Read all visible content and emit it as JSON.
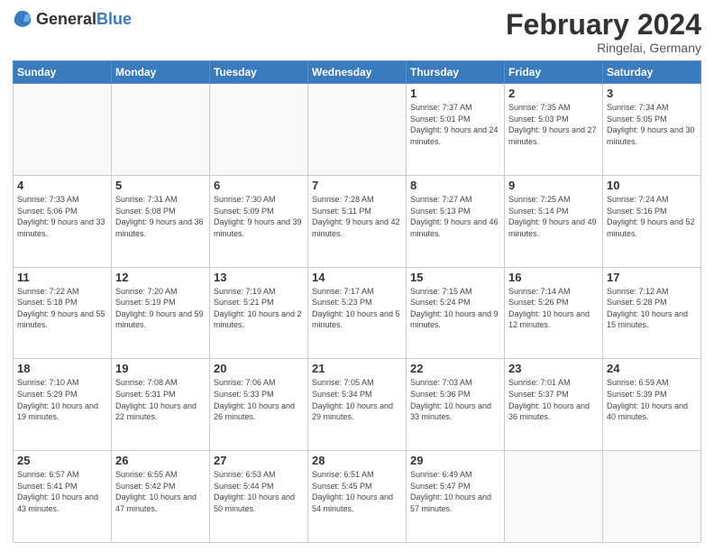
{
  "header": {
    "logo_general": "General",
    "logo_blue": "Blue",
    "month_title": "February 2024",
    "location": "Ringelai, Germany"
  },
  "days_of_week": [
    "Sunday",
    "Monday",
    "Tuesday",
    "Wednesday",
    "Thursday",
    "Friday",
    "Saturday"
  ],
  "weeks": [
    [
      {
        "day": "",
        "info": ""
      },
      {
        "day": "",
        "info": ""
      },
      {
        "day": "",
        "info": ""
      },
      {
        "day": "",
        "info": ""
      },
      {
        "day": "1",
        "info": "Sunrise: 7:37 AM\nSunset: 5:01 PM\nDaylight: 9 hours and 24 minutes."
      },
      {
        "day": "2",
        "info": "Sunrise: 7:35 AM\nSunset: 5:03 PM\nDaylight: 9 hours and 27 minutes."
      },
      {
        "day": "3",
        "info": "Sunrise: 7:34 AM\nSunset: 5:05 PM\nDaylight: 9 hours and 30 minutes."
      }
    ],
    [
      {
        "day": "4",
        "info": "Sunrise: 7:33 AM\nSunset: 5:06 PM\nDaylight: 9 hours and 33 minutes."
      },
      {
        "day": "5",
        "info": "Sunrise: 7:31 AM\nSunset: 5:08 PM\nDaylight: 9 hours and 36 minutes."
      },
      {
        "day": "6",
        "info": "Sunrise: 7:30 AM\nSunset: 5:09 PM\nDaylight: 9 hours and 39 minutes."
      },
      {
        "day": "7",
        "info": "Sunrise: 7:28 AM\nSunset: 5:11 PM\nDaylight: 9 hours and 42 minutes."
      },
      {
        "day": "8",
        "info": "Sunrise: 7:27 AM\nSunset: 5:13 PM\nDaylight: 9 hours and 46 minutes."
      },
      {
        "day": "9",
        "info": "Sunrise: 7:25 AM\nSunset: 5:14 PM\nDaylight: 9 hours and 49 minutes."
      },
      {
        "day": "10",
        "info": "Sunrise: 7:24 AM\nSunset: 5:16 PM\nDaylight: 9 hours and 52 minutes."
      }
    ],
    [
      {
        "day": "11",
        "info": "Sunrise: 7:22 AM\nSunset: 5:18 PM\nDaylight: 9 hours and 55 minutes."
      },
      {
        "day": "12",
        "info": "Sunrise: 7:20 AM\nSunset: 5:19 PM\nDaylight: 9 hours and 59 minutes."
      },
      {
        "day": "13",
        "info": "Sunrise: 7:19 AM\nSunset: 5:21 PM\nDaylight: 10 hours and 2 minutes."
      },
      {
        "day": "14",
        "info": "Sunrise: 7:17 AM\nSunset: 5:23 PM\nDaylight: 10 hours and 5 minutes."
      },
      {
        "day": "15",
        "info": "Sunrise: 7:15 AM\nSunset: 5:24 PM\nDaylight: 10 hours and 9 minutes."
      },
      {
        "day": "16",
        "info": "Sunrise: 7:14 AM\nSunset: 5:26 PM\nDaylight: 10 hours and 12 minutes."
      },
      {
        "day": "17",
        "info": "Sunrise: 7:12 AM\nSunset: 5:28 PM\nDaylight: 10 hours and 15 minutes."
      }
    ],
    [
      {
        "day": "18",
        "info": "Sunrise: 7:10 AM\nSunset: 5:29 PM\nDaylight: 10 hours and 19 minutes."
      },
      {
        "day": "19",
        "info": "Sunrise: 7:08 AM\nSunset: 5:31 PM\nDaylight: 10 hours and 22 minutes."
      },
      {
        "day": "20",
        "info": "Sunrise: 7:06 AM\nSunset: 5:33 PM\nDaylight: 10 hours and 26 minutes."
      },
      {
        "day": "21",
        "info": "Sunrise: 7:05 AM\nSunset: 5:34 PM\nDaylight: 10 hours and 29 minutes."
      },
      {
        "day": "22",
        "info": "Sunrise: 7:03 AM\nSunset: 5:36 PM\nDaylight: 10 hours and 33 minutes."
      },
      {
        "day": "23",
        "info": "Sunrise: 7:01 AM\nSunset: 5:37 PM\nDaylight: 10 hours and 36 minutes."
      },
      {
        "day": "24",
        "info": "Sunrise: 6:59 AM\nSunset: 5:39 PM\nDaylight: 10 hours and 40 minutes."
      }
    ],
    [
      {
        "day": "25",
        "info": "Sunrise: 6:57 AM\nSunset: 5:41 PM\nDaylight: 10 hours and 43 minutes."
      },
      {
        "day": "26",
        "info": "Sunrise: 6:55 AM\nSunset: 5:42 PM\nDaylight: 10 hours and 47 minutes."
      },
      {
        "day": "27",
        "info": "Sunrise: 6:53 AM\nSunset: 5:44 PM\nDaylight: 10 hours and 50 minutes."
      },
      {
        "day": "28",
        "info": "Sunrise: 6:51 AM\nSunset: 5:45 PM\nDaylight: 10 hours and 54 minutes."
      },
      {
        "day": "29",
        "info": "Sunrise: 6:49 AM\nSunset: 5:47 PM\nDaylight: 10 hours and 57 minutes."
      },
      {
        "day": "",
        "info": ""
      },
      {
        "day": "",
        "info": ""
      }
    ]
  ]
}
